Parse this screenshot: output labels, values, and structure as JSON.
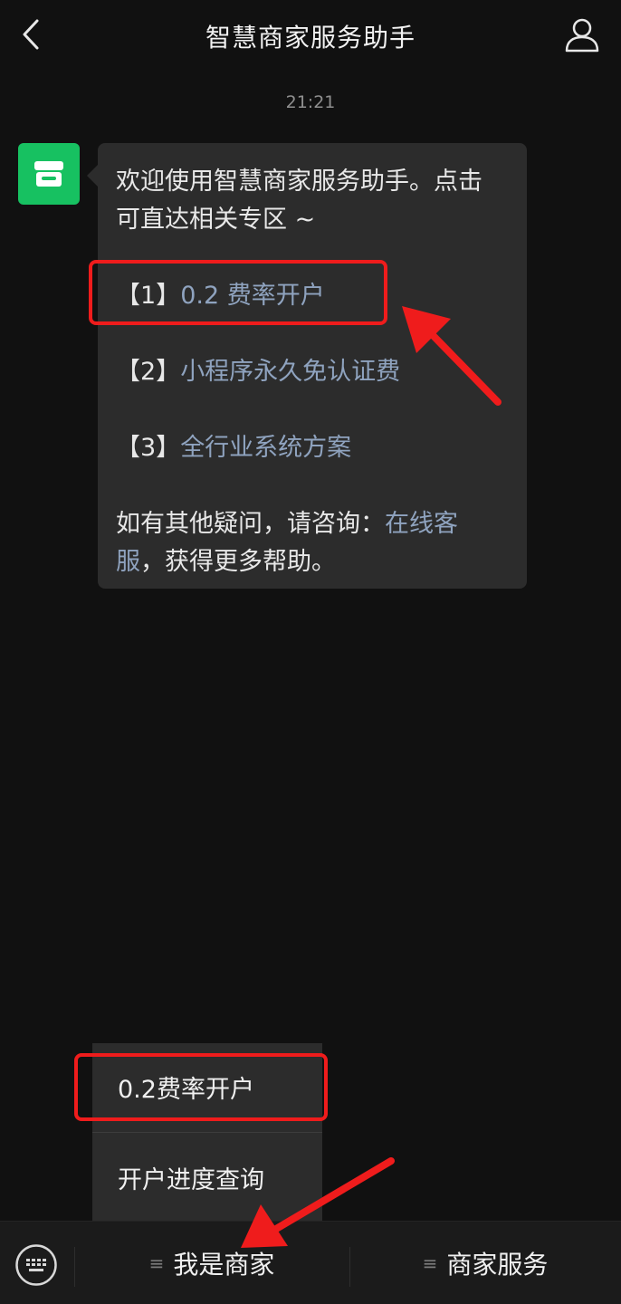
{
  "header": {
    "title": "智慧商家服务助手"
  },
  "chat": {
    "time": "21:21",
    "bubble": {
      "intro_line1": "欢迎使用智慧商家服务助手。点击",
      "intro_line2": "可直达相关专区 ~",
      "items": [
        {
          "prefix": "【1】",
          "link": "0.2 费率开户"
        },
        {
          "prefix": "【2】",
          "link": "小程序永久免认证费"
        },
        {
          "prefix": "【3】",
          "link": "全行业系统方案"
        }
      ],
      "footer_line1_text": "如有其他疑问，请咨询：",
      "footer_line1_link": "在线客",
      "footer_line2_link": "服",
      "footer_line2_text": "，获得更多帮助。"
    }
  },
  "menu_popup": {
    "items": [
      "0.2费率开户",
      "开户进度查询"
    ]
  },
  "bottom_bar": {
    "tabs": [
      {
        "icon": "≡",
        "label": "我是商家"
      },
      {
        "icon": "≡",
        "label": "商家服务"
      }
    ]
  },
  "colors": {
    "background": "#111111",
    "bubble": "#2c2c2c",
    "link": "#8fa3bf",
    "avatar": "#17c161",
    "highlight": "#ef1c1c"
  },
  "icons": {
    "back": "chevron-left-icon",
    "profile": "person-icon",
    "avatar": "store-icon",
    "keyboard": "keyboard-icon"
  }
}
